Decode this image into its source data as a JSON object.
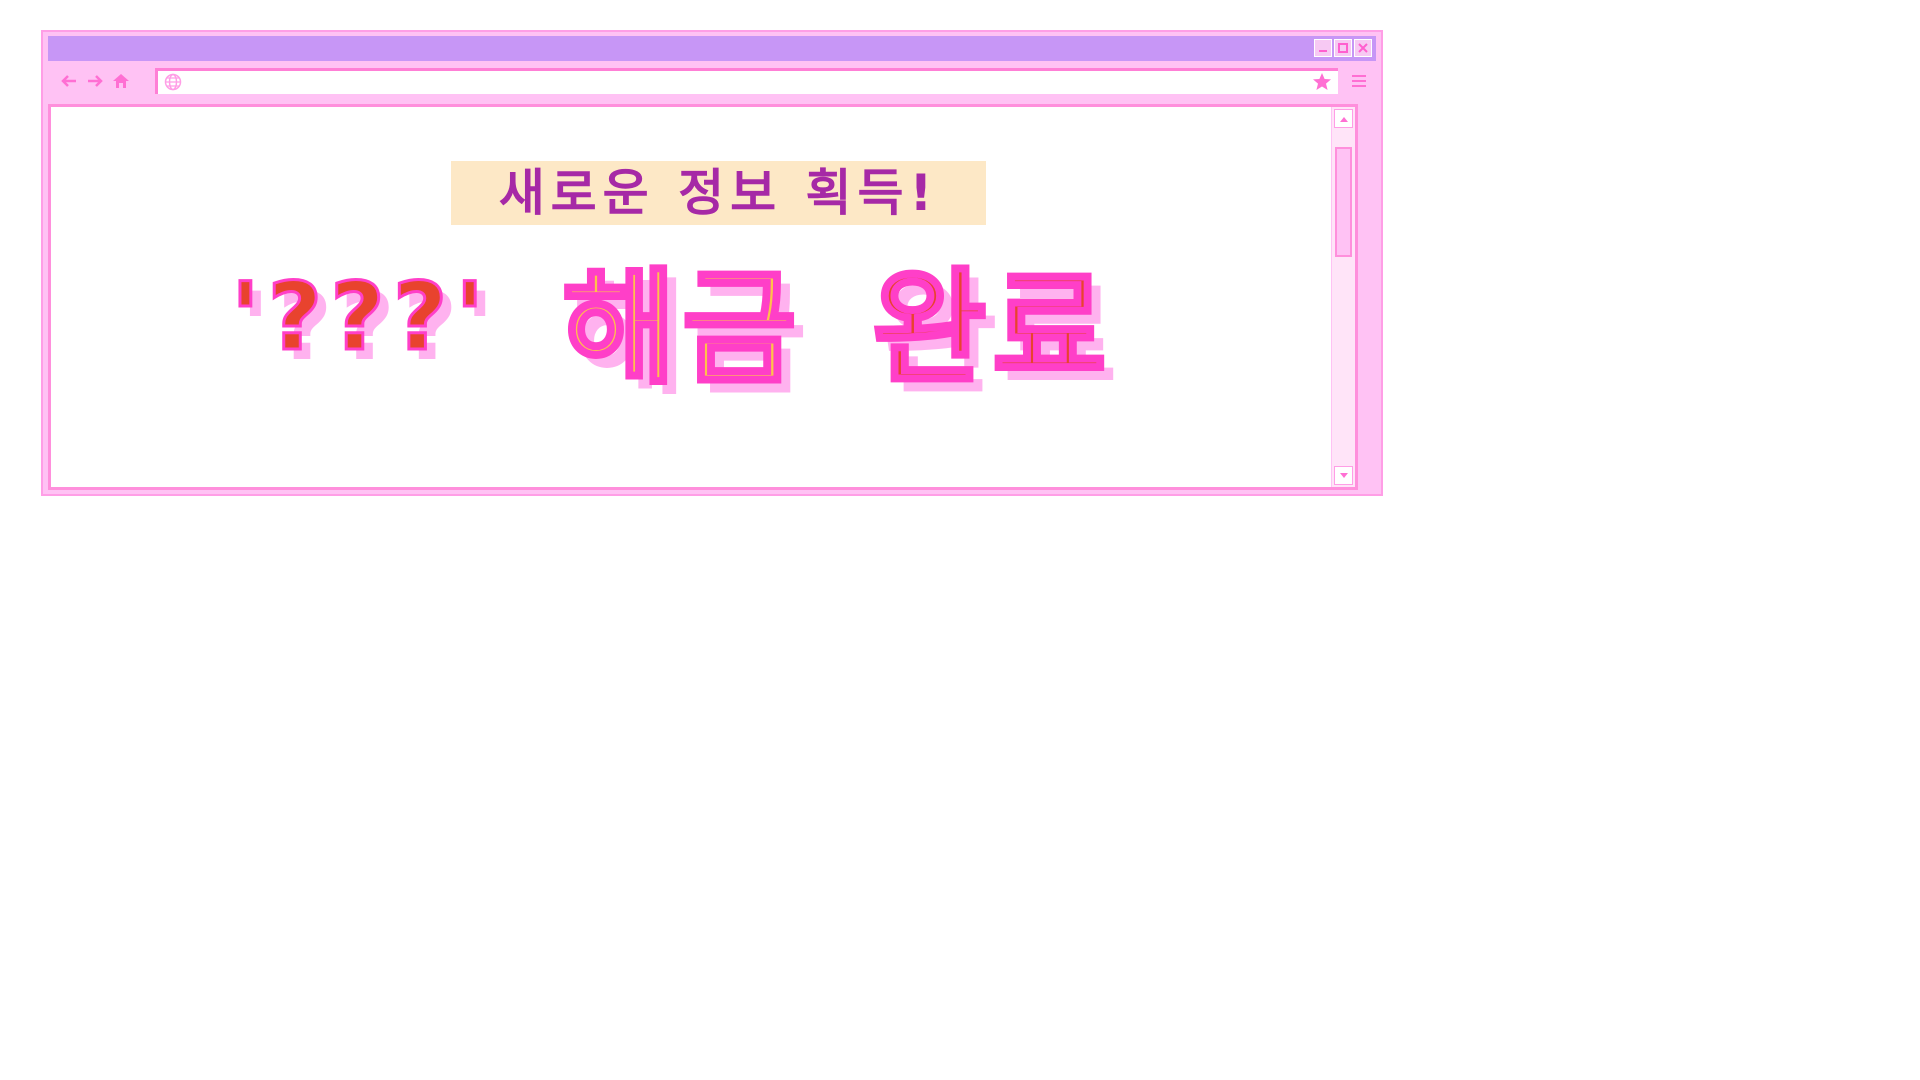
{
  "window": {
    "buttons": {
      "minimize_icon": "minimize-icon",
      "maximize_icon": "maximize-icon",
      "close_icon": "close-icon"
    }
  },
  "toolbar": {
    "address_value": "",
    "icons": [
      "back-arrow-icon",
      "forward-arrow-icon",
      "home-icon",
      "globe-icon",
      "star-icon",
      "menu-icon"
    ]
  },
  "content": {
    "subtitle": "새로운 정보 획득!",
    "headline_secret": "'???'",
    "headline_unlock": "해금",
    "headline_done": "완료"
  },
  "colors": {
    "titlebar": "#c796f6",
    "frame": "#ffc2f4",
    "accent_pink": "#ff3fc8",
    "headline_red": "#e8432e",
    "headline_yellow": "#ffc24a",
    "subtitle_purple": "#a629a6",
    "subtitle_bg": "#fde8c6"
  }
}
